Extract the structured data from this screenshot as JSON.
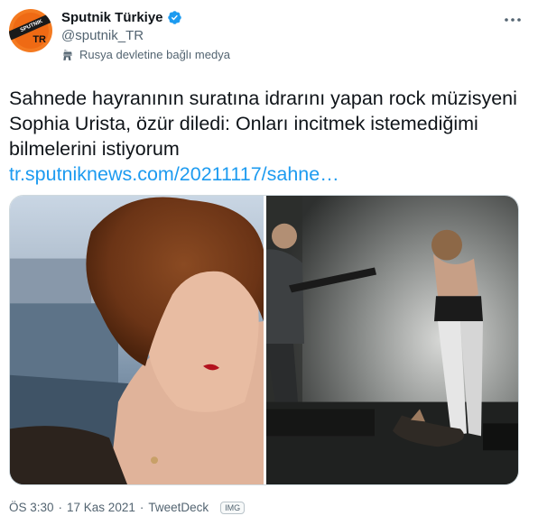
{
  "account": {
    "display_name": "Sputnik Türkiye",
    "handle": "@sputnik_TR",
    "avatar_band_text": "SPUTNIK",
    "avatar_text": "TR",
    "verified_icon": "verified-badge-icon",
    "label_icon": "state-media-icon",
    "label_text": "Rusya devletine bağlı medya"
  },
  "tweet": {
    "text": "Sahnede hayranının suratına idrarını yapan rock müzisyeni Sophia Urista, özür diledi: Onları incitmek istemediğimi bilmelerini istiyorum",
    "link_text": "tr.sputniknews.com/20211117/sahne…"
  },
  "media": {
    "photos": [
      {
        "name": "portrait-photo"
      },
      {
        "name": "concert-stage-photo"
      }
    ]
  },
  "meta": {
    "time": "ÖS 3:30",
    "separator": "·",
    "date": "17 Kas 2021",
    "source": "TweetDeck",
    "badge": "IMG"
  },
  "colors": {
    "text": "#0f1419",
    "secondary": "#536471",
    "link": "#1d9bf0",
    "verified": "#1d9bf0",
    "avatar": "#f47a20"
  }
}
